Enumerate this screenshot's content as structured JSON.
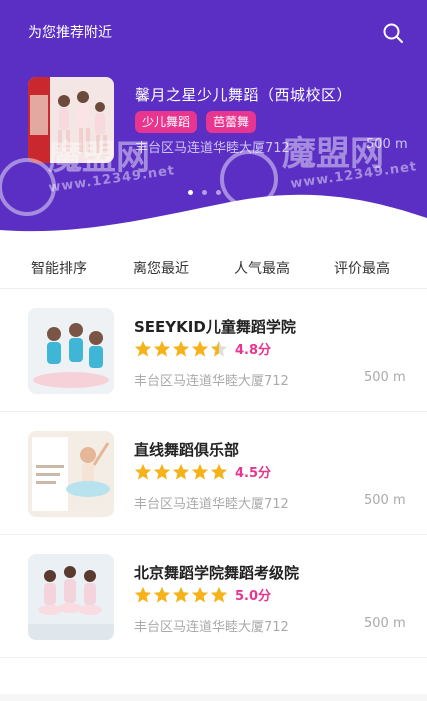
{
  "header": {
    "title": "为您推荐附近",
    "accent": "#5b2ec4"
  },
  "featured": {
    "name": "馨月之星少儿舞蹈（西城校区）",
    "tags": [
      "少儿舞蹈",
      "芭蕾舞"
    ],
    "address": "丰台区马连道华睦大厦712",
    "distance": "500 m",
    "pager": {
      "count": 3,
      "active": 0
    }
  },
  "sort": [
    "智能排序",
    "离您最近",
    "人气最高",
    "评价最高"
  ],
  "list": [
    {
      "name": "SEEYKID儿童舞蹈学院",
      "rating": 4.5,
      "score": "4.8分",
      "address": "丰台区马连道华睦大厦712",
      "distance": "500 m"
    },
    {
      "name": "直线舞蹈俱乐部",
      "rating": 5,
      "score": "4.5分",
      "address": "丰台区马连道华睦大厦712",
      "distance": "500 m"
    },
    {
      "name": "北京舞蹈学院舞蹈考级院",
      "rating": 5,
      "score": "5.0分",
      "address": "丰台区马连道华睦大厦712",
      "distance": "500 m"
    }
  ],
  "watermark": {
    "mark": "魔盟网",
    "url": "www.12349.net"
  },
  "icons": {
    "search": "search-icon",
    "star": "star-icon"
  }
}
